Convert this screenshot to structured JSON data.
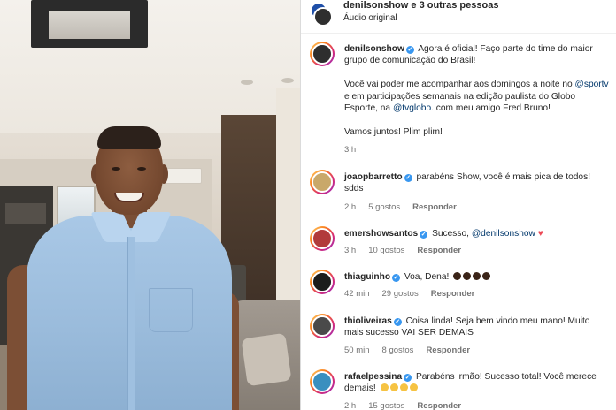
{
  "header": {
    "title_user": "denilsonshow",
    "title_rest": " e 3 outras pessoas",
    "subtitle": "Áudio original"
  },
  "post": {
    "username": "denilsonshow",
    "text_1": "Agora é oficial! Faço parte do time do maior grupo de comunicação do Brasil!",
    "text_2a": "Você vai poder me acompanhar aos domingos a noite no ",
    "mention_1": "@sportv",
    "text_2b": " e em participações semanais na edição paulista do Globo Esporte, na ",
    "mention_2": "@tvglobo",
    "text_2c": ". com meu amigo Fred Bruno!",
    "text_3": "Vamos juntos! Plim plim!",
    "time": "3 h"
  },
  "comments": [
    {
      "username": "joaopbarretto",
      "text": "parabéns Show, você é mais pica de todos! sdds",
      "time": "2 h",
      "likes": "5 gostos",
      "reply": "Responder",
      "avatar_color": "#c9a86a"
    },
    {
      "username": "emershowsantos",
      "text": "Sucesso, ",
      "mention": "@denilsonshow",
      "heart": "♥",
      "time": "3 h",
      "likes": "10 gostos",
      "reply": "Responder",
      "avatar_color": "#b23b3b"
    },
    {
      "username": "thiaguinho",
      "text": "Voa, Dena!",
      "time": "42 min",
      "likes": "29 gostos",
      "reply": "Responder",
      "avatar_color": "#1c1c1c"
    },
    {
      "username": "thioliveiras",
      "text": "Coisa linda! Seja bem vindo meu mano! Muito mais sucesso VAI SER DEMAIS",
      "time": "50 min",
      "likes": "8 gostos",
      "reply": "Responder",
      "avatar_color": "#4a4a4a"
    },
    {
      "username": "rafaelpessina",
      "text": "Parabéns irmão! Sucesso total! Você merece demais!",
      "time": "2 h",
      "likes": "15 gostos",
      "reply": "Responder",
      "avatar_color": "#3a8fbf"
    }
  ],
  "colors": {
    "verified": "#3897f0",
    "mention": "#00376b",
    "meta": "#737373",
    "heart": "#ed4956"
  }
}
